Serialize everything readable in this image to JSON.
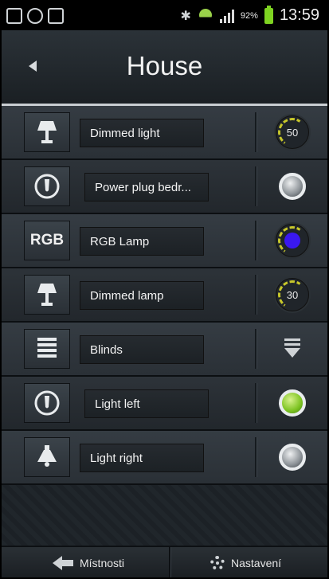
{
  "status_bar": {
    "battery": "92%",
    "time": "13:59"
  },
  "header": {
    "title": "House"
  },
  "rows": [
    {
      "label": "Dimmed light",
      "icon": "lamp-icon",
      "control": "dimmer",
      "value": "50"
    },
    {
      "label": "Power plug bedr...",
      "icon": "power-plug-icon",
      "control": "toggle-off"
    },
    {
      "label": "RGB Lamp",
      "icon": "rgb-icon",
      "icon_text": "RGB",
      "control": "rgb",
      "color": "#3a18f0"
    },
    {
      "label": "Dimmed lamp",
      "icon": "lamp-icon",
      "control": "dimmer",
      "value": "30"
    },
    {
      "label": "Blinds",
      "icon": "blinds-icon",
      "control": "down-arrow"
    },
    {
      "label": "Light left",
      "icon": "power-plug-icon",
      "control": "toggle-on"
    },
    {
      "label": "Light right",
      "icon": "ceiling-lamp-icon",
      "control": "toggle-off"
    }
  ],
  "bottom_bar": {
    "rooms_label": "Místnosti",
    "settings_label": "Nastavení"
  },
  "colors": {
    "toggle_on": "#7cc321",
    "knob_arc": "#c7c72b",
    "rgb_dot": "#3a18f0"
  }
}
